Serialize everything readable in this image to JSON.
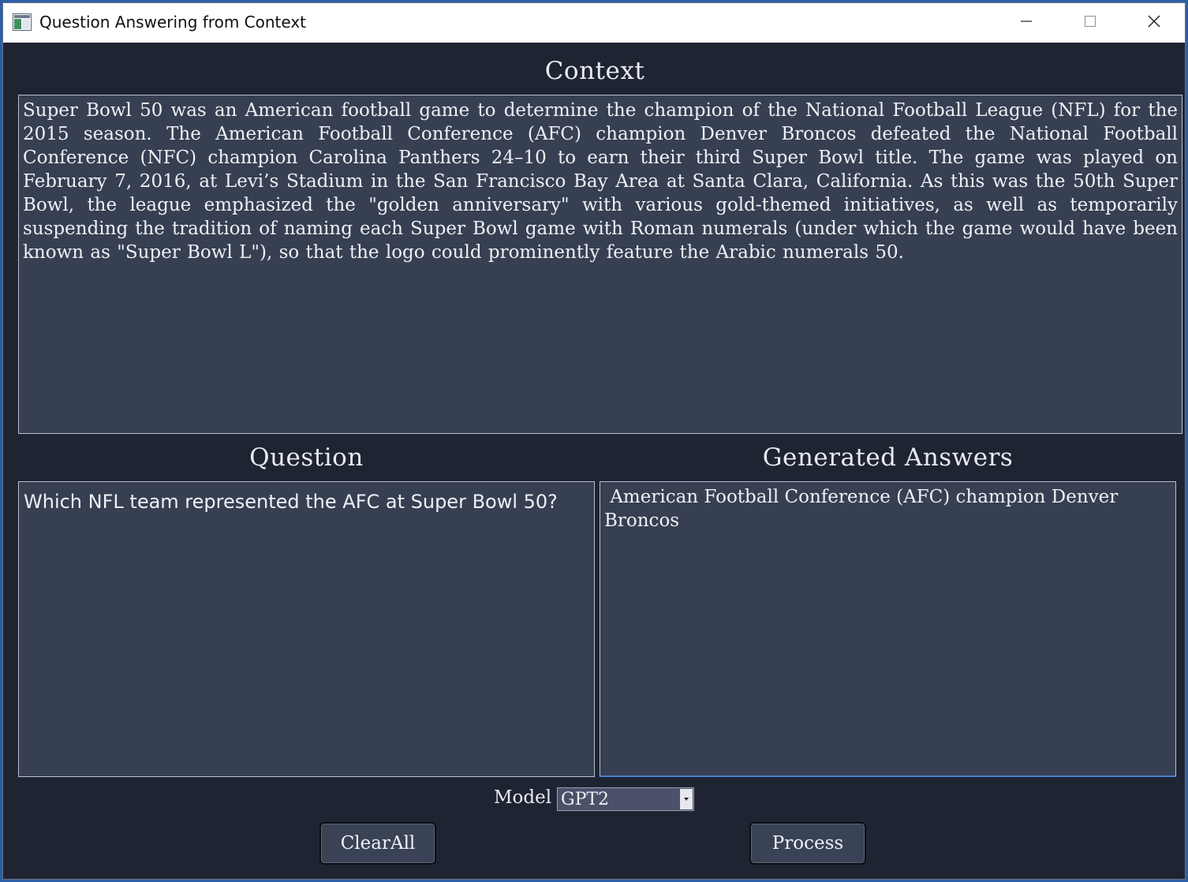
{
  "window": {
    "title": "Question Answering from Context"
  },
  "context": {
    "heading": "Context",
    "text": "Super Bowl 50 was an American football game to determine the champion of the National Football League (NFL) for the 2015 season. The American Football Conference (AFC) champion Denver Broncos defeated the National Football Conference (NFC) champion Carolina Panthers 24–10 to earn their third Super Bowl title. The game was played on February 7, 2016, at Levi’s Stadium in the San Francisco Bay Area at Santa Clara, California. As this was the 50th Super Bowl, the league emphasized the \"golden anniversary\" with various gold-themed initiatives, as well as temporarily suspending the tradition of naming each Super Bowl game with Roman numerals (under which the game would have been known as \"Super Bowl L\"), so that the logo could prominently feature the Arabic numerals 50."
  },
  "question": {
    "heading": "Question",
    "text": "Which NFL team represented the AFC at Super Bowl 50?"
  },
  "answers": {
    "heading": "Generated Answers",
    "text": " American Football Conference (AFC) champion Denver Broncos"
  },
  "model": {
    "label": "Model",
    "selected": "GPT2"
  },
  "buttons": {
    "clear_label": "ClearAll",
    "process_label": "Process"
  },
  "icons": {
    "app": "app-window-icon",
    "minimize": "minimize-icon",
    "maximize": "maximize-icon",
    "close": "close-icon",
    "dropdown": "chevron-down-icon"
  }
}
